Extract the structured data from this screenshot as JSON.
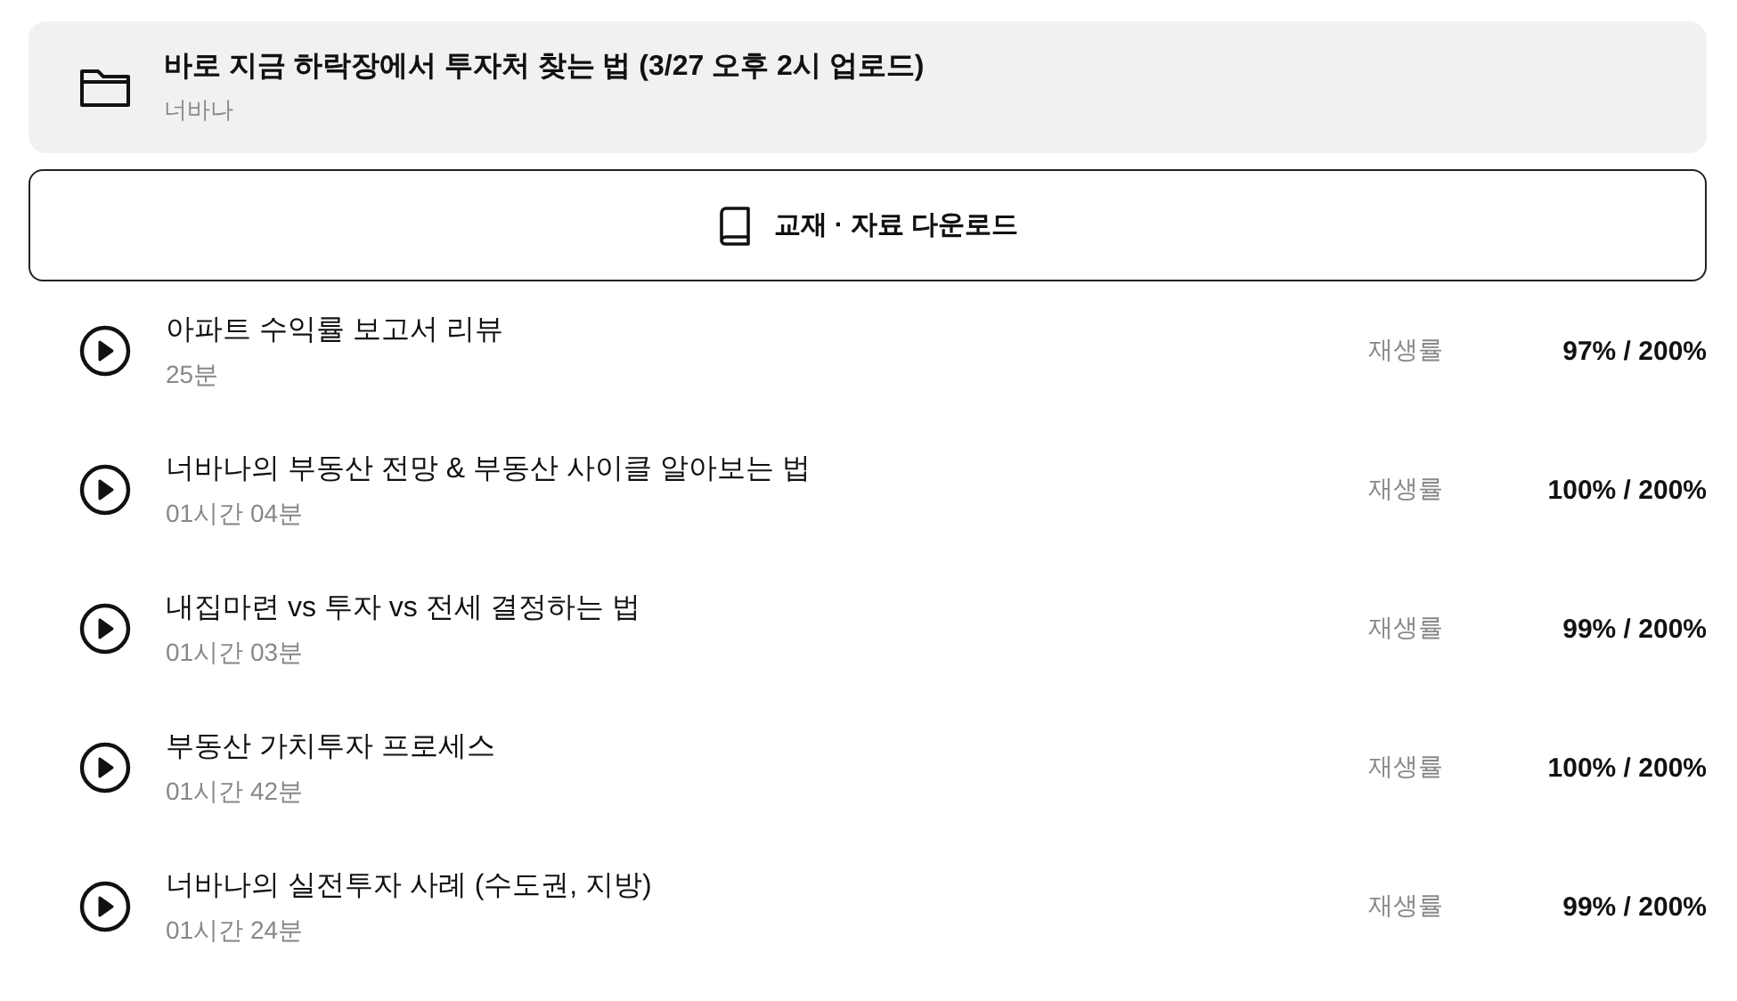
{
  "folder": {
    "title": "바로 지금 하락장에서 투자처 찾는 법 (3/27 오후 2시 업로드)",
    "author": "너바나"
  },
  "download_button": {
    "label": "교재 · 자료 다운로드"
  },
  "lessons": [
    {
      "title": "아파트 수익률 보고서 리뷰",
      "duration": "25분",
      "rate_label": "재생률",
      "rate": "97% / 200%"
    },
    {
      "title": "너바나의 부동산 전망 & 부동산 사이클 알아보는 법",
      "duration": "01시간 04분",
      "rate_label": "재생률",
      "rate": "100% / 200%"
    },
    {
      "title": "내집마련 vs 투자 vs 전세 결정하는 법",
      "duration": "01시간 03분",
      "rate_label": "재생률",
      "rate": "99% / 200%"
    },
    {
      "title": "부동산 가치투자 프로세스",
      "duration": "01시간 42분",
      "rate_label": "재생률",
      "rate": "100% / 200%"
    },
    {
      "title": "너바나의 실전투자 사례 (수도권, 지방)",
      "duration": "01시간 24분",
      "rate_label": "재생률",
      "rate": "99% / 200%"
    }
  ]
}
